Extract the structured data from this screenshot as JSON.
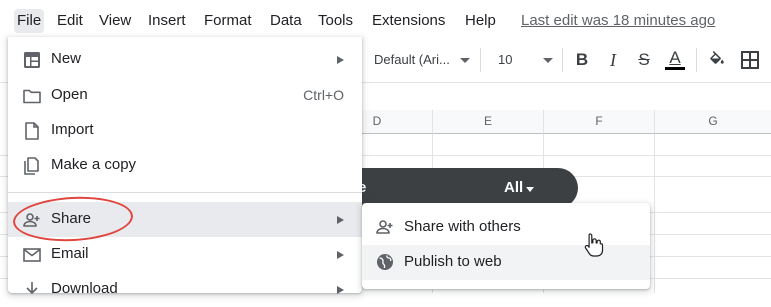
{
  "menubar": {
    "items": [
      "File",
      "Edit",
      "View",
      "Insert",
      "Format",
      "Data",
      "Tools",
      "Extensions",
      "Help"
    ],
    "last_edit": "Last edit was 18 minutes ago"
  },
  "toolbar": {
    "font": "Default (Ari...",
    "font_size": "10",
    "icons": [
      "bold-icon",
      "italic-icon",
      "strikethrough-icon",
      "text-color-icon",
      "fill-color-icon",
      "borders-icon"
    ],
    "bold_label": "B",
    "italic_label": "I",
    "strike_label": "S",
    "text_color_label": "A",
    "text_color": "#000000"
  },
  "columns": [
    "D",
    "E",
    "F",
    "G"
  ],
  "filter_bar": {
    "label": "e",
    "option": "All"
  },
  "file_menu": {
    "items": [
      {
        "label": "New",
        "icon": "new-sheet-icon",
        "submenu": true
      },
      {
        "label": "Open",
        "icon": "folder-icon",
        "shortcut": "Ctrl+O"
      },
      {
        "label": "Import",
        "icon": "import-icon"
      },
      {
        "label": "Make a copy",
        "icon": "copy-icon"
      },
      {
        "label": "Share",
        "icon": "share-person-icon",
        "submenu": true,
        "highlighted": true
      },
      {
        "label": "Email",
        "icon": "email-icon",
        "submenu": true
      },
      {
        "label": "Download",
        "icon": "download-icon",
        "submenu": true
      }
    ]
  },
  "share_submenu": {
    "items": [
      {
        "label": "Share with others",
        "icon": "person-add-icon"
      },
      {
        "label": "Publish to web",
        "icon": "globe-icon",
        "highlighted": true
      }
    ]
  },
  "colors": {
    "annotation": "#e0463f",
    "dark_bar": "#3c4043",
    "hover": "#e8eaed"
  }
}
